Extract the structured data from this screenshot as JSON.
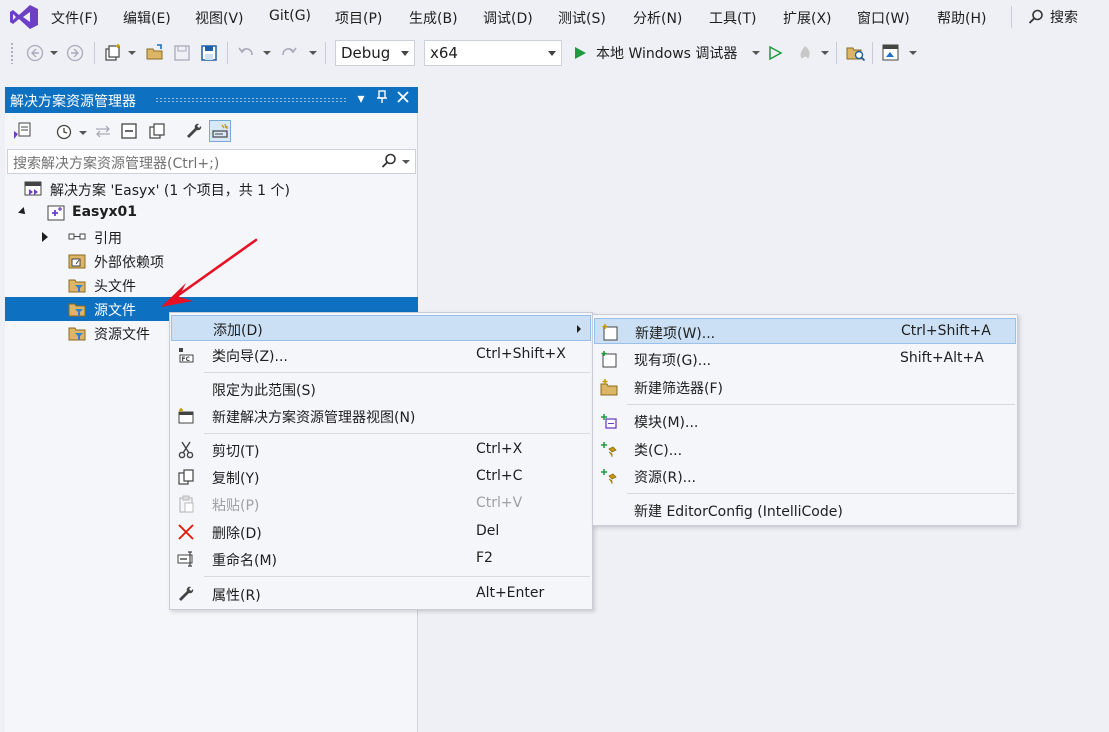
{
  "menubar": {
    "items": [
      "文件(F)",
      "编辑(E)",
      "视图(V)",
      "Git(G)",
      "项目(P)",
      "生成(B)",
      "调试(D)",
      "测试(S)",
      "分析(N)",
      "工具(T)",
      "扩展(X)",
      "窗口(W)",
      "帮助(H)"
    ],
    "search_label": "搜索"
  },
  "toolbar": {
    "configuration": "Debug",
    "platform": "x64",
    "run_label": "本地 Windows 调试器"
  },
  "solution_explorer": {
    "title": "解决方案资源管理器",
    "search_placeholder": "搜索解决方案资源管理器(Ctrl+;)",
    "tree": {
      "solution": "解决方案 'Easyx' (1 个项目，共 1 个)",
      "project": "Easyx01",
      "references": "引用",
      "external_deps": "外部依赖项",
      "header_files": "头文件",
      "source_files": "源文件",
      "resource_files": "资源文件"
    }
  },
  "context_menu": {
    "add": "添加(D)",
    "class_wizard": "类向导(Z)...",
    "class_wizard_sc": "Ctrl+Shift+X",
    "scope": "限定为此范围(S)",
    "new_view": "新建解决方案资源管理器视图(N)",
    "cut": "剪切(T)",
    "cut_sc": "Ctrl+X",
    "copy": "复制(Y)",
    "copy_sc": "Ctrl+C",
    "paste": "粘贴(P)",
    "paste_sc": "Ctrl+V",
    "delete": "删除(D)",
    "delete_sc": "Del",
    "rename": "重命名(M)",
    "rename_sc": "F2",
    "properties": "属性(R)",
    "properties_sc": "Alt+Enter"
  },
  "submenu": {
    "new_item": "新建项(W)...",
    "new_item_sc": "Ctrl+Shift+A",
    "existing_item": "现有项(G)...",
    "existing_item_sc": "Shift+Alt+A",
    "new_filter": "新建筛选器(F)",
    "module": "模块(M)...",
    "class": "类(C)...",
    "resource": "资源(R)...",
    "editorconfig": "新建 EditorConfig (IntelliCode)"
  },
  "colors": {
    "accent": "#0e70c0",
    "highlight": "#cce0f5",
    "annotation_arrow": "#e81123"
  }
}
